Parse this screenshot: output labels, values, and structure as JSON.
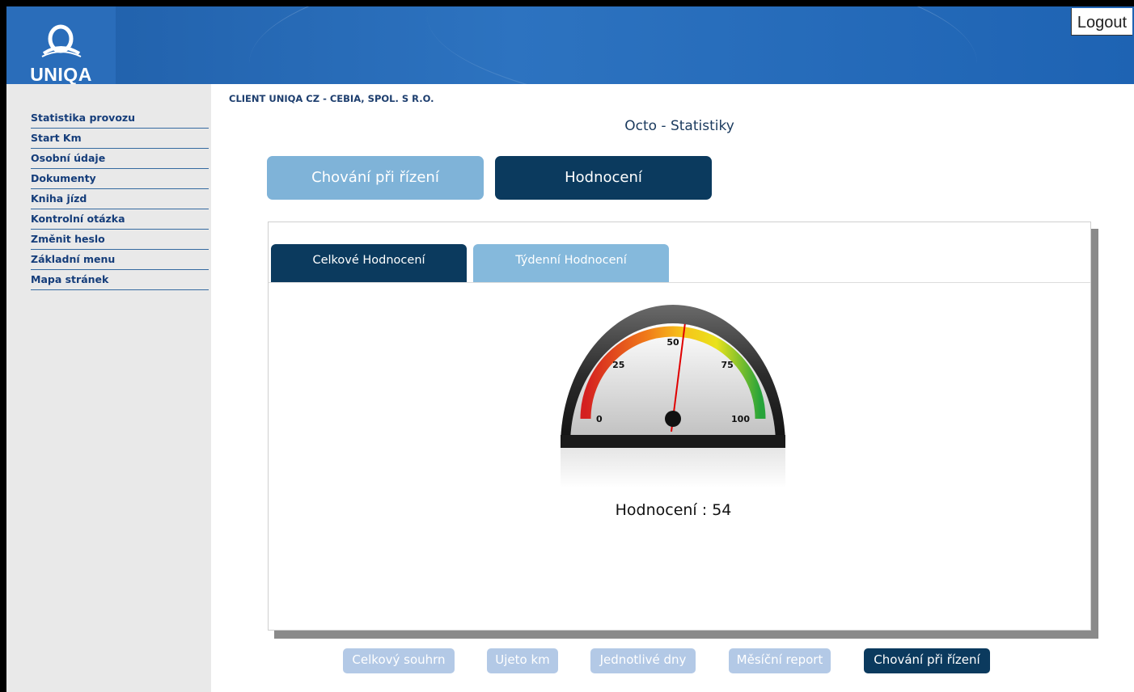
{
  "brand": {
    "name": "UNIQA",
    "color": "#2a6dba"
  },
  "header": {
    "logout_label": "Logout"
  },
  "sidebar": {
    "items": [
      {
        "label": "Statistika provozu"
      },
      {
        "label": "Start Km"
      },
      {
        "label": "Osobní údaje"
      },
      {
        "label": "Dokumenty"
      },
      {
        "label": "Kniha jízd"
      },
      {
        "label": "Kontrolní otázka"
      },
      {
        "label": "Změnit heslo"
      },
      {
        "label": "Základní menu"
      },
      {
        "label": "Mapa stránek"
      }
    ]
  },
  "client_label": "CLIENT UNIQA CZ - CEBIA, SPOL. S R.O.",
  "page_title": "Octo - Statistiky",
  "main_tabs": [
    {
      "label": "Chování při řízení",
      "active": false
    },
    {
      "label": "Hodnocení",
      "active": true
    }
  ],
  "sub_tabs": [
    {
      "label": "Celkové Hodnocení",
      "active": true
    },
    {
      "label": "Týdenní Hodnocení",
      "active": false
    }
  ],
  "gauge": {
    "min": 0,
    "max": 100,
    "value": 54,
    "tick_labels": [
      "0",
      "25",
      "50",
      "75",
      "100"
    ],
    "needle_color": "#e00000"
  },
  "score": {
    "label": "Hodnocení",
    "separator": " : ",
    "value": "54"
  },
  "bottom_nav": [
    {
      "label": "Celkový souhrn",
      "active": false
    },
    {
      "label": "Ujeto km",
      "active": false
    },
    {
      "label": "Jednotlivé dny",
      "active": false
    },
    {
      "label": "Měsíční report",
      "active": false
    },
    {
      "label": "Chování při řízení",
      "active": true
    }
  ],
  "colors": {
    "dark_navy": "#0b3a5e",
    "light_blue": "#7fb3d8",
    "inactive_button": "#b3c9e6"
  }
}
